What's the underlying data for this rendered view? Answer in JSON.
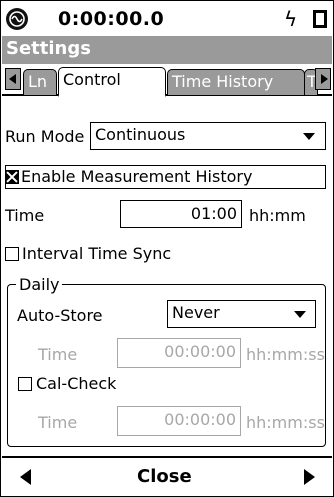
{
  "status": {
    "clock": "0:00:00.0",
    "bolt_icon": "lightning-bolt-icon",
    "battery_icon": "battery-icon"
  },
  "title": "Settings",
  "tabs": [
    {
      "label": "Ln",
      "active": false
    },
    {
      "label": "Control",
      "active": true
    },
    {
      "label": "Time History",
      "active": false
    },
    {
      "label": "T",
      "active": false
    }
  ],
  "run_mode": {
    "label": "Run Mode",
    "value": "Continuous"
  },
  "enable_history": {
    "label": "Enable Measurement History",
    "checked": true
  },
  "time": {
    "label": "Time",
    "value": "01:00",
    "unit": "hh:mm"
  },
  "interval_sync": {
    "label": "Interval Time Sync",
    "checked": false
  },
  "daily": {
    "title": "Daily",
    "auto_store": {
      "label": "Auto-Store",
      "value": "Never"
    },
    "time1": {
      "label": "Time",
      "value": "00:00:00",
      "unit": "hh:mm:ss"
    },
    "cal_check": {
      "label": "Cal-Check",
      "checked": false
    },
    "time2": {
      "label": "Time",
      "value": "00:00:00",
      "unit": "hh:mm:ss"
    }
  },
  "bottom": {
    "close": "Close"
  }
}
